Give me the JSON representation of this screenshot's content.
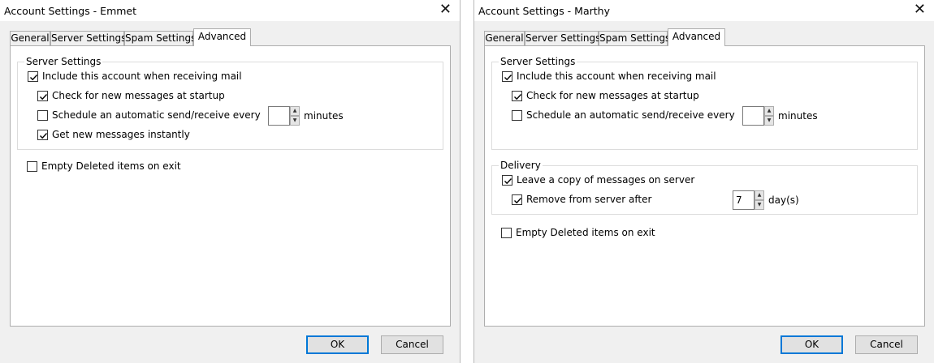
{
  "left": {
    "title": "Account Settings - Emmet",
    "close_glyph": "✕",
    "tabs": [
      "General",
      "Server Settings",
      "Spam Settings",
      "Advanced"
    ],
    "active_tab": "Advanced",
    "server_group": {
      "title": "Server Settings",
      "include_label": "Include this account when receiving mail",
      "include_checked": true,
      "startup_label": "Check for new messages at startup",
      "startup_checked": true,
      "schedule_label": "Schedule an automatic send/receive every",
      "schedule_checked": false,
      "schedule_value": "",
      "schedule_unit": "minutes",
      "instant_label": "Get new messages instantly",
      "instant_checked": true
    },
    "empty_deleted_label": "Empty Deleted items on exit",
    "empty_deleted_checked": false,
    "ok_label": "OK",
    "cancel_label": "Cancel"
  },
  "right": {
    "title": "Account Settings - Marthy",
    "close_glyph": "✕",
    "tabs": [
      "General",
      "Server Settings",
      "Spam Settings",
      "Advanced"
    ],
    "active_tab": "Advanced",
    "server_group": {
      "title": "Server Settings",
      "include_label": "Include this account when receiving mail",
      "include_checked": true,
      "startup_label": "Check for new messages at startup",
      "startup_checked": true,
      "schedule_label": "Schedule an automatic send/receive every",
      "schedule_checked": false,
      "schedule_value": "",
      "schedule_unit": "minutes"
    },
    "delivery_group": {
      "title": "Delivery",
      "leave_copy_label": "Leave a copy of messages on server",
      "leave_copy_checked": true,
      "remove_label": "Remove from server after",
      "remove_checked": true,
      "remove_value": "7",
      "remove_unit": "day(s)"
    },
    "empty_deleted_label": "Empty Deleted items on exit",
    "empty_deleted_checked": false,
    "ok_label": "OK",
    "cancel_label": "Cancel"
  },
  "icons": {
    "close": "close-icon",
    "checkmark": "checkmark-icon",
    "spin_up": "spin-up-arrow-icon",
    "spin_down": "spin-down-arrow-icon"
  },
  "colors": {
    "dialog_bg": "#f0f0f0",
    "panel_bg": "#ffffff",
    "default_button_border": "#0078d7",
    "button_bg": "#e1e1e1"
  }
}
